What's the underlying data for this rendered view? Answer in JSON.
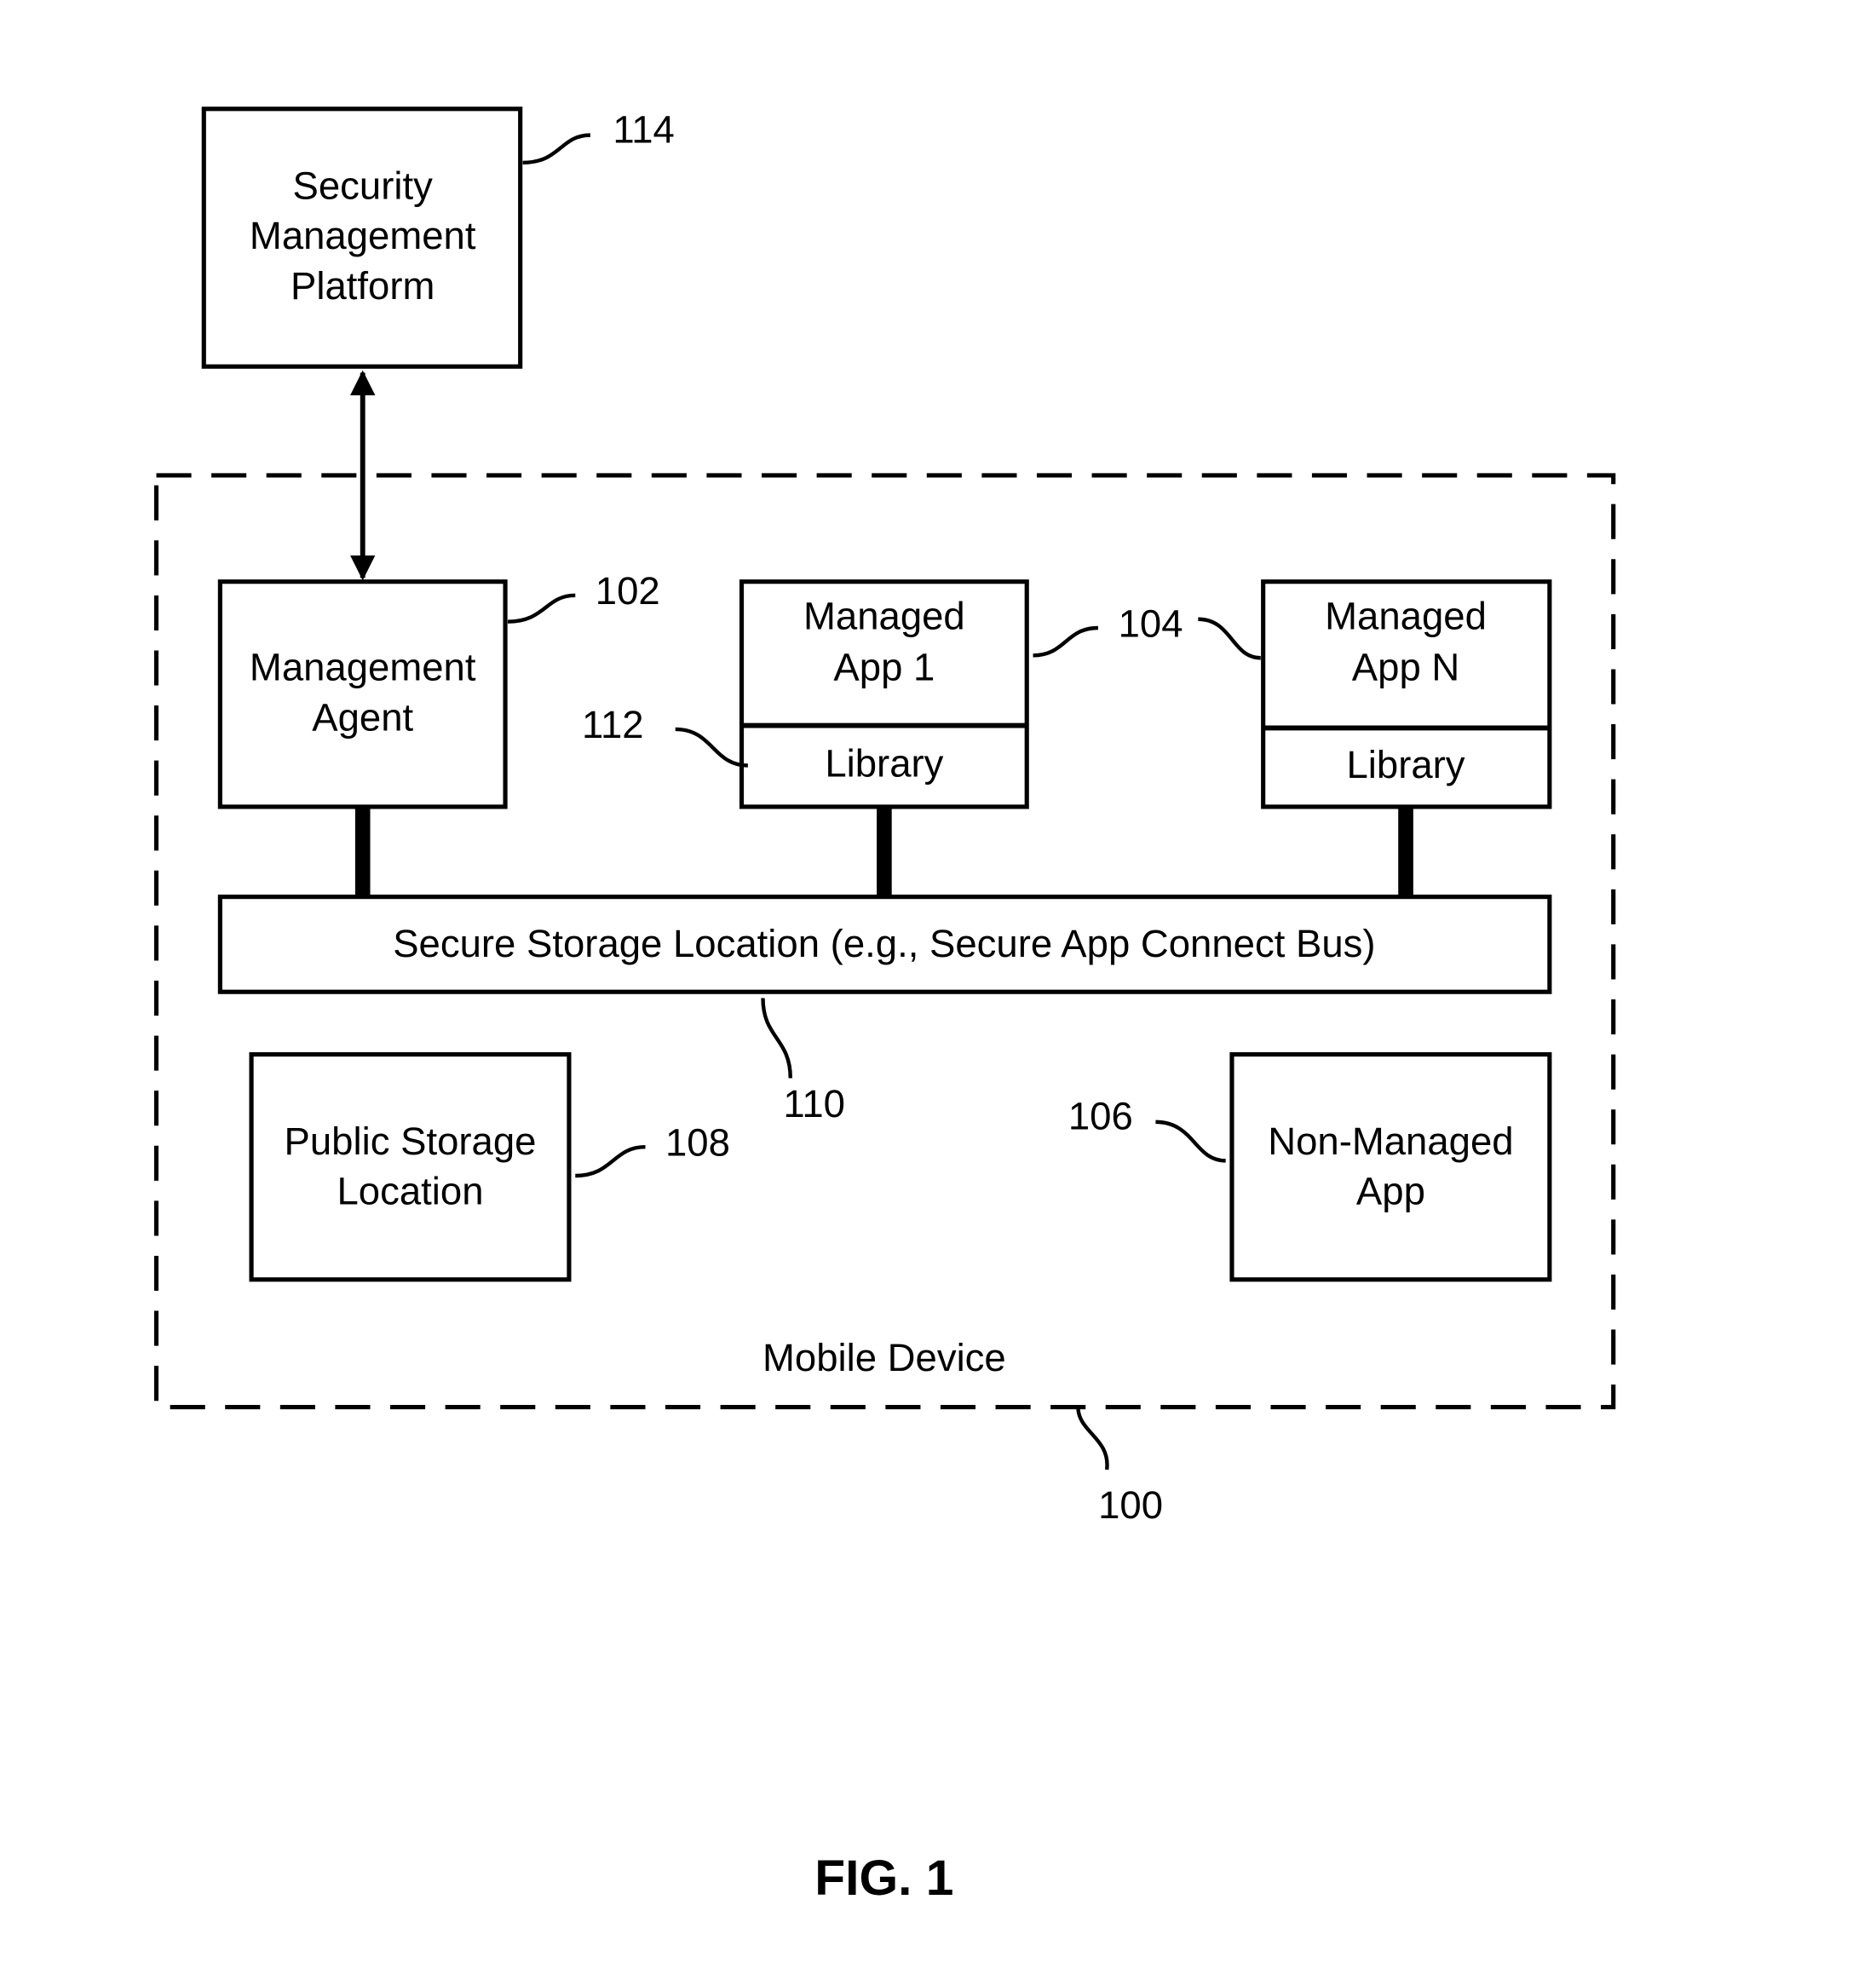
{
  "figure": {
    "caption": "FIG. 1",
    "container": {
      "label": "Mobile Device",
      "ref": "100"
    },
    "security_platform": {
      "lines": [
        "Security",
        "Management",
        "Platform"
      ],
      "ref": "114"
    },
    "management_agent": {
      "lines": [
        "Management",
        "Agent"
      ],
      "ref": "102"
    },
    "managed_app_1": {
      "lines": [
        "Managed",
        "App 1"
      ],
      "library": "Library"
    },
    "managed_app_n": {
      "lines": [
        "Managed",
        "App N"
      ],
      "library": "Library"
    },
    "managed_apps_ref": "104",
    "library_ref": "112",
    "secure_storage": {
      "label": "Secure Storage Location (e.g., Secure App Connect Bus)",
      "ref": "110"
    },
    "public_storage": {
      "lines": [
        "Public Storage",
        "Location"
      ],
      "ref": "108"
    },
    "non_managed_app": {
      "lines": [
        "Non-Managed",
        "App"
      ],
      "ref": "106"
    }
  }
}
